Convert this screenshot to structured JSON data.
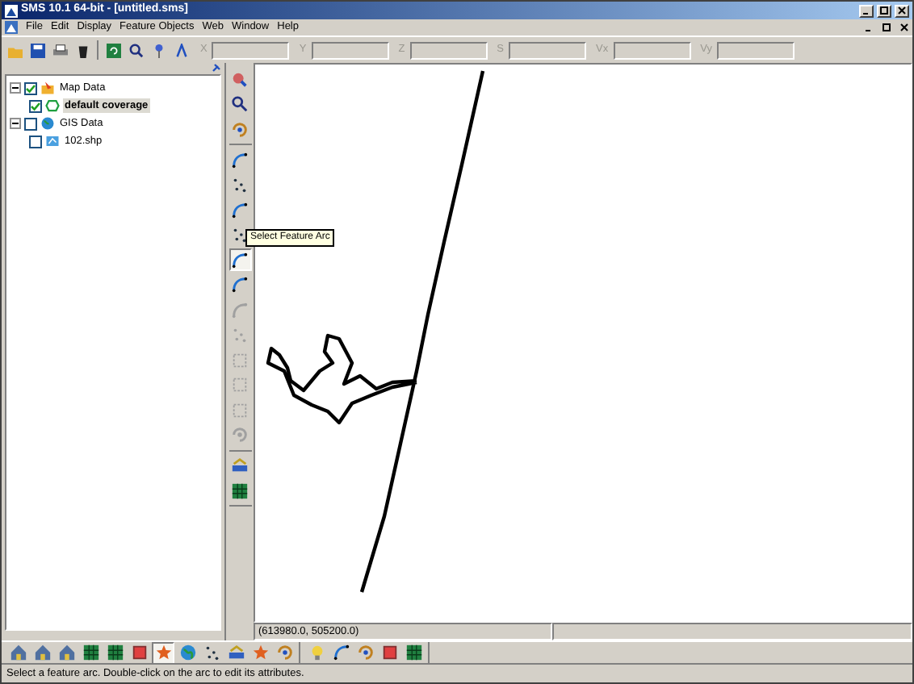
{
  "window": {
    "title": "SMS 10.1 64-bit - [untitled.sms]"
  },
  "menu": [
    "File",
    "Edit",
    "Display",
    "Feature Objects",
    "Web",
    "Window",
    "Help"
  ],
  "toolbar": {
    "fields": [
      {
        "label": "X",
        "disabled": true
      },
      {
        "label": "Y",
        "disabled": true
      },
      {
        "label": "Z",
        "disabled": true
      },
      {
        "label": "S",
        "disabled": true
      },
      {
        "label": "Vx",
        "disabled": true
      },
      {
        "label": "Vy",
        "disabled": true
      }
    ]
  },
  "tree": [
    {
      "label": "Map Data",
      "kind": "folder",
      "checked": true,
      "expanded": true,
      "selected": false,
      "children": [
        {
          "label": "default coverage",
          "kind": "coverage",
          "checked": true,
          "selected": true
        }
      ]
    },
    {
      "label": "GIS Data",
      "kind": "globe",
      "checked": false,
      "expanded": true,
      "selected": false,
      "children": [
        {
          "label": "102.shp",
          "kind": "shape",
          "checked": false,
          "selected": false
        }
      ]
    }
  ],
  "vertical_toolbar": {
    "groups": [
      {
        "tools": [
          {
            "kind": "zoom",
            "selected": false,
            "disabled": false
          },
          {
            "kind": "search",
            "selected": false,
            "disabled": false
          },
          {
            "kind": "rotate",
            "selected": false,
            "disabled": false
          }
        ]
      },
      {
        "tools": [
          {
            "kind": "arc",
            "selected": false,
            "disabled": false
          },
          {
            "kind": "points",
            "selected": false,
            "disabled": false
          },
          {
            "kind": "arc",
            "selected": false,
            "disabled": false
          },
          {
            "kind": "points",
            "selected": false,
            "disabled": false
          },
          {
            "kind": "arc",
            "selected": true,
            "disabled": false
          },
          {
            "kind": "arc",
            "selected": false,
            "disabled": false
          },
          {
            "kind": "arc",
            "selected": false,
            "disabled": true
          },
          {
            "kind": "points",
            "selected": false,
            "disabled": true
          },
          {
            "kind": "square",
            "selected": false,
            "disabled": true
          },
          {
            "kind": "square",
            "selected": false,
            "disabled": true
          },
          {
            "kind": "square",
            "selected": false,
            "disabled": true
          },
          {
            "kind": "rotate",
            "selected": false,
            "disabled": true
          }
        ]
      },
      {
        "tools": [
          {
            "kind": "layers",
            "selected": false,
            "disabled": false
          },
          {
            "kind": "grid",
            "selected": false,
            "disabled": false
          }
        ]
      }
    ]
  },
  "tooltip": "Select Feature Arc",
  "coordinates": "(613980.0, 505200.0)",
  "bottom_toolbar": {
    "groups": [
      {
        "tools": [
          {
            "kind": "house",
            "selected": false
          },
          {
            "kind": "house",
            "selected": false
          },
          {
            "kind": "house",
            "selected": false
          },
          {
            "kind": "grid",
            "selected": false
          },
          {
            "kind": "grid",
            "selected": false
          },
          {
            "kind": "square",
            "selected": false
          },
          {
            "kind": "star",
            "selected": true
          },
          {
            "kind": "globe",
            "selected": false
          },
          {
            "kind": "points",
            "selected": false
          },
          {
            "kind": "layers",
            "selected": false
          },
          {
            "kind": "star",
            "selected": false
          },
          {
            "kind": "rotate",
            "selected": false
          }
        ]
      },
      {
        "tools": [
          {
            "kind": "bulb",
            "selected": false
          },
          {
            "kind": "arc",
            "selected": false
          },
          {
            "kind": "rotate",
            "selected": false
          },
          {
            "kind": "square",
            "selected": false
          },
          {
            "kind": "grid",
            "selected": false
          }
        ]
      }
    ]
  },
  "status_bar": "Select a feature arc. Double-click on the arc to edit its attributes."
}
